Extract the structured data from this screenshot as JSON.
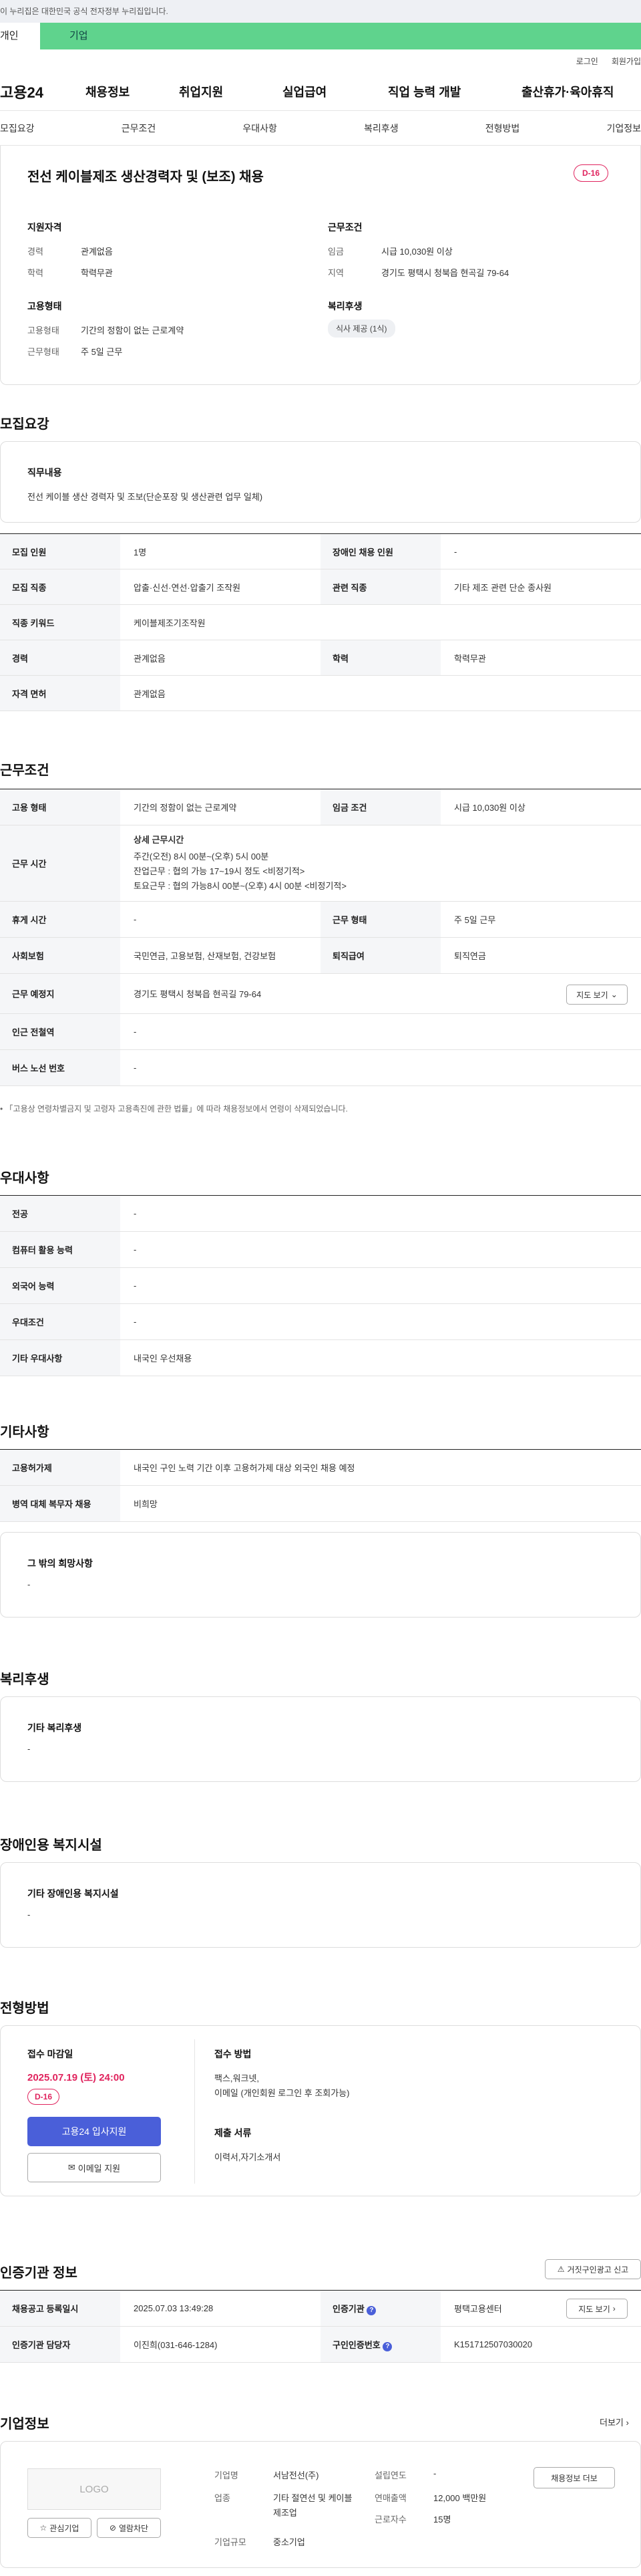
{
  "banner": {
    "text": "이 누리집은 대한민국 공식 전자정부 누리집입니다."
  },
  "site_tabs": [
    {
      "label": "개인"
    },
    {
      "label": "기업"
    }
  ],
  "util": {
    "login": "로그인",
    "join": "회원가입"
  },
  "gnb": {
    "logo": "고용24",
    "menu": [
      "채용정보",
      "취업지원",
      "실업급여",
      "직업 능력 개발",
      "출산휴가·육아휴직"
    ]
  },
  "snb": [
    "모집요강",
    "근무조건",
    "우대사항",
    "복리후생",
    "전형방법",
    "기업정보"
  ],
  "job": {
    "title": "전선 케이블제조 생산경력자 및 (보조) 채용",
    "dday": "D-16"
  },
  "summary": {
    "qual_title": "지원자격",
    "career_label": "경력",
    "career": "관계없음",
    "edu_label": "학력",
    "edu": "학력무관",
    "cond_title": "근무조건",
    "wage_label": "임금",
    "wage": "시급 10,030원 이상",
    "region_label": "지역",
    "region": "경기도 평택시 청북읍 현곡길 79-64",
    "emp_title": "고용형태",
    "emp_type_label": "고용형태",
    "emp_type": "기간의 정함이 없는 근로계약",
    "work_type_label": "근무형태",
    "work_type": "주 5일 근무",
    "welfare_title": "복리후생",
    "welfare_tag": "식사 제공 (1식)"
  },
  "recruit": {
    "heading": "모집요강",
    "duty_title": "직무내용",
    "duty": "전선 케이블 생산 경력자 및 조보(단순포장 및 생산관련 업무 일체)",
    "rows": {
      "count_label": "모집 인원",
      "count": "1명",
      "disabled_label": "장애인 채용 인원",
      "disabled": "-",
      "job_label": "모집 직종",
      "job": "압출·신선·연선·압출기 조작원",
      "rel_label": "관련 직종",
      "rel": "기타 제조 관련 단순 종사원",
      "kw_label": "직종 키워드",
      "kw": "케이블제조기조작원",
      "car_label": "경력",
      "car": "관계없음",
      "edu_label": "학력",
      "edu": "학력무관",
      "lic_label": "자격 면허",
      "lic": "관계없음"
    }
  },
  "cond": {
    "heading": "근무조건",
    "emp_label": "고용 형태",
    "emp": "기간의 정함이 없는 근로계약",
    "wage_label": "임금 조건",
    "wage": "시급 10,030원 이상",
    "time_label": "근무 시간",
    "time_title": "상세 근무시간",
    "time_lines": [
      "주간(오전) 8시 00분~(오후) 5시 00분",
      "잔업근무 : 협의 가능 17~19시 정도 <비정기적>",
      "토요근무 : 협의 가능8시 00분~(오후) 4시 00분 <비정기적>"
    ],
    "break_label": "휴게 시간",
    "break": "-",
    "form_label": "근무 형태",
    "form": "주 5일 근무",
    "ins_label": "사회보험",
    "ins": "국민연금, 고용보험, 산재보험, 건강보험",
    "ret_label": "퇴직급여",
    "ret": "퇴직연금",
    "place_label": "근무 예정지",
    "place": "경기도 평택시 청북읍 현곡길 79-64",
    "map_btn": "지도 보기",
    "subway_label": "인근 전철역",
    "subway": "-",
    "bus_label": "버스 노선 번호",
    "bus": "-",
    "note": "「고용상 연령차별금지 및 고령자 고용촉진에 관한 법률」에 따라 채용정보에서 연령이 삭제되었습니다."
  },
  "pref": {
    "heading": "우대사항",
    "rows": [
      {
        "label": "전공",
        "value": "-"
      },
      {
        "label": "컴퓨터 활용 능력",
        "value": "-"
      },
      {
        "label": "외국어 능력",
        "value": "-"
      },
      {
        "label": "우대조건",
        "value": "-"
      },
      {
        "label": "기타 우대사항",
        "value": "내국인 우선채용"
      }
    ]
  },
  "etc": {
    "heading": "기타사항",
    "rows": [
      {
        "label": "고용허가제",
        "value": "내국인 구인 노력 기간 이후 고용허가제 대상 외국인 채용 예정"
      },
      {
        "label": "병역 대체 복무자 채용",
        "value": "비희망"
      }
    ],
    "other_title": "그 밖의 희망사항",
    "other": "-"
  },
  "welfare": {
    "heading": "복리후생",
    "title": "기타 복리후생",
    "value": "-"
  },
  "disab": {
    "heading": "장애인용 복지시설",
    "title": "기타 장애인용 복지시설",
    "value": "-"
  },
  "screen": {
    "heading": "전형방법",
    "deadline_title": "접수 마감일",
    "deadline": "2025.07.19 (토) 24:00",
    "dday": "D-16",
    "apply_btn": "고용24 입사지원",
    "email_btn": "이메일 지원",
    "method_title": "접수 방법",
    "method_lines": [
      "팩스,워크넷,",
      "이메일 (개인회원 로그인 후 조회가능)"
    ],
    "docs_title": "제출 서류",
    "docs": "이력서,자기소개서"
  },
  "cert": {
    "heading": "인증기관 정보",
    "report_btn": "거짓구인광고 신고",
    "date_label": "채용공고 등록일시",
    "date": "2025.07.03 13:49:28",
    "org_label": "인증기관",
    "org": "평택고용센터",
    "map_btn": "지도 보기",
    "mgr_label": "인증기관 담당자",
    "mgr": "이진희(031-646-1284)",
    "no_label": "구인인증번호",
    "no": "K151712507030020"
  },
  "company": {
    "heading": "기업정보",
    "more": "더보기",
    "logo": "LOGO",
    "fav_btn": "관심기업",
    "block_btn": "열람차단",
    "name_label": "기업명",
    "name": "서남전선(주)",
    "year_label": "설립연도",
    "year": "-",
    "biz_label": "업종",
    "biz": "기타 절연선 및 케이블 제조업",
    "sales_label": "연매출액",
    "sales": "12,000 백만원",
    "emp_label": "근로자수",
    "emp": "15명",
    "size_label": "기업규모",
    "size": "중소기업",
    "list_btn": "채용정보 더보",
    "colors": {
      "accent": "#4a5fd9",
      "dday": "#e0245e",
      "banner": "#5fd38d"
    }
  }
}
